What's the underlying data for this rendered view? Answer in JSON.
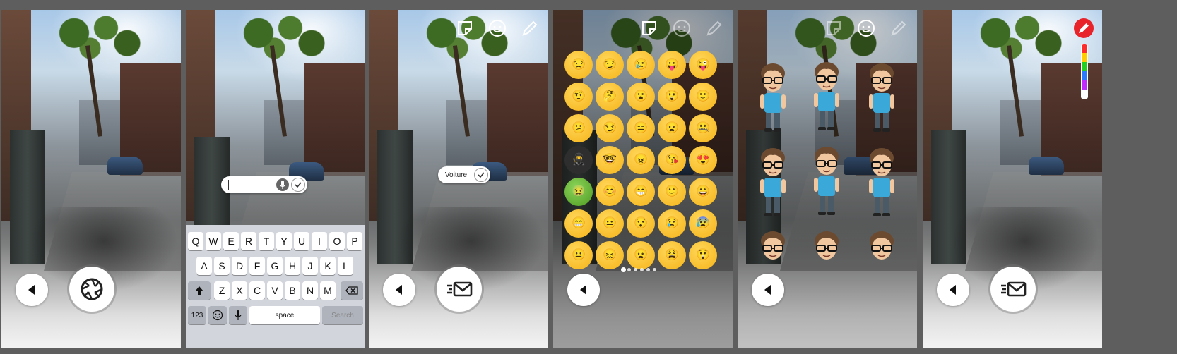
{
  "panels": [
    {
      "id": "camera"
    },
    {
      "id": "text-entry"
    },
    {
      "id": "text-placed"
    },
    {
      "id": "emoji-picker"
    },
    {
      "id": "avatar-picker"
    },
    {
      "id": "draw"
    }
  ],
  "text_entry": {
    "input_value": ""
  },
  "text_placed": {
    "label": "Voiture"
  },
  "keyboard": {
    "row1": [
      "Q",
      "W",
      "E",
      "R",
      "T",
      "Y",
      "U",
      "I",
      "O",
      "P"
    ],
    "row2": [
      "A",
      "S",
      "D",
      "F",
      "G",
      "H",
      "J",
      "K",
      "L"
    ],
    "row3": [
      "Z",
      "X",
      "C",
      "V",
      "B",
      "N",
      "M"
    ],
    "numbers_key": "123",
    "space_key": "space",
    "search_key": "Search"
  },
  "emoji_grid": [
    "😒",
    "😏",
    "😢",
    "😛",
    "😜",
    "🤨",
    "🤔",
    "😮",
    "😲",
    "🙂",
    "😕",
    "😏",
    "😑",
    "😦",
    "🤐",
    "🥷",
    "🤓",
    "😠",
    "😘",
    "😍",
    "🤢",
    "😊",
    "😁",
    "🙂",
    "😀",
    "😁",
    "😐",
    "😯",
    "😢",
    "😰",
    "😐",
    "😖",
    "😦",
    "😩",
    "😲"
  ],
  "emoji_pager": {
    "pages": 6,
    "current": 1
  },
  "draw_colors": [
    "#ff2a2a",
    "#ffcc00",
    "#22d022",
    "#2a7bff",
    "#c02aff",
    "#ffffff"
  ],
  "icons": {
    "back": "back-arrow-icon",
    "shutter": "camera-shutter-icon",
    "send": "send-mail-icon",
    "sticker": "sticker-icon",
    "emoji": "emoji-icon",
    "pencil": "pencil-icon",
    "mic": "microphone-icon",
    "check": "checkmark-icon"
  }
}
